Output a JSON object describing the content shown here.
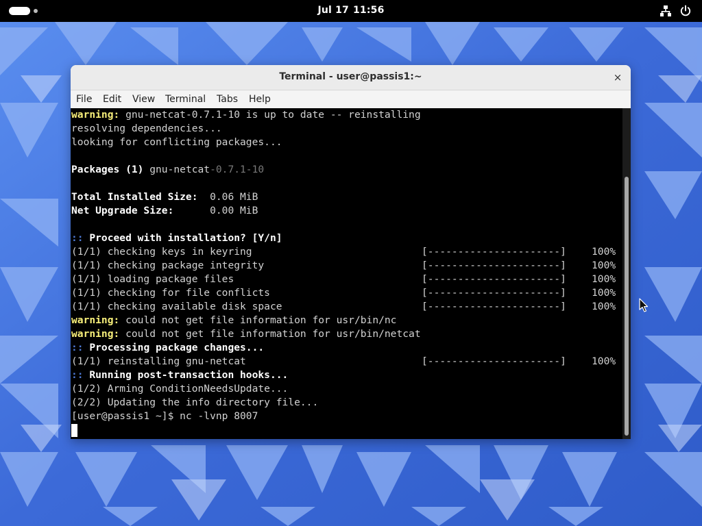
{
  "topbar": {
    "date": "Jul 17",
    "time": "11:56",
    "icons": [
      "activities-icon",
      "network-icon",
      "power-icon"
    ]
  },
  "window": {
    "title": "Terminal - user@passis1:~",
    "close_glyph": "×"
  },
  "menubar": {
    "items": [
      {
        "label": "File"
      },
      {
        "label": "Edit"
      },
      {
        "label": "View"
      },
      {
        "label": "Terminal"
      },
      {
        "label": "Tabs"
      },
      {
        "label": "Help"
      }
    ]
  },
  "terminal": {
    "lines": [
      {
        "segments": [
          {
            "t": "warning:",
            "c": "warn"
          },
          {
            "t": " gnu-netcat-0.7.1-10 is up to date -- reinstalling",
            "c": ""
          }
        ]
      },
      {
        "segments": [
          {
            "t": "resolving dependencies...",
            "c": ""
          }
        ]
      },
      {
        "segments": [
          {
            "t": "looking for conflicting packages...",
            "c": ""
          }
        ]
      },
      {
        "segments": []
      },
      {
        "segments": [
          {
            "t": "Packages (1)",
            "c": "b"
          },
          {
            "t": " gnu-netcat",
            "c": ""
          },
          {
            "t": "-0.7.1-10",
            "c": "dim"
          }
        ]
      },
      {
        "segments": []
      },
      {
        "segments": [
          {
            "t": "Total Installed Size:",
            "c": "b"
          },
          {
            "t": "  0.06 MiB",
            "c": ""
          }
        ]
      },
      {
        "segments": [
          {
            "t": "Net Upgrade Size:",
            "c": "b"
          },
          {
            "t": "      0.00 MiB",
            "c": ""
          }
        ]
      },
      {
        "segments": []
      },
      {
        "segments": [
          {
            "t": "::",
            "c": "blue"
          },
          {
            "t": " Proceed with installation? [Y/n]",
            "c": "b"
          }
        ]
      },
      {
        "segments": [
          {
            "t": "(1/1) checking keys in keyring",
            "c": ""
          }
        ],
        "bar": "[----------------------]",
        "pct": "100%"
      },
      {
        "segments": [
          {
            "t": "(1/1) checking package integrity",
            "c": ""
          }
        ],
        "bar": "[----------------------]",
        "pct": "100%"
      },
      {
        "segments": [
          {
            "t": "(1/1) loading package files",
            "c": ""
          }
        ],
        "bar": "[----------------------]",
        "pct": "100%"
      },
      {
        "segments": [
          {
            "t": "(1/1) checking for file conflicts",
            "c": ""
          }
        ],
        "bar": "[----------------------]",
        "pct": "100%"
      },
      {
        "segments": [
          {
            "t": "(1/1) checking available disk space",
            "c": ""
          }
        ],
        "bar": "[----------------------]",
        "pct": "100%"
      },
      {
        "segments": [
          {
            "t": "warning:",
            "c": "warn"
          },
          {
            "t": " could not get file information for usr/bin/nc",
            "c": ""
          }
        ]
      },
      {
        "segments": [
          {
            "t": "warning:",
            "c": "warn"
          },
          {
            "t": " could not get file information for usr/bin/netcat",
            "c": ""
          }
        ]
      },
      {
        "segments": [
          {
            "t": "::",
            "c": "blue"
          },
          {
            "t": " Processing package changes...",
            "c": "b"
          }
        ]
      },
      {
        "segments": [
          {
            "t": "(1/1) reinstalling gnu-netcat",
            "c": ""
          }
        ],
        "bar": "[----------------------]",
        "pct": "100%"
      },
      {
        "segments": [
          {
            "t": "::",
            "c": "blue"
          },
          {
            "t": " Running post-transaction hooks...",
            "c": "b"
          }
        ]
      },
      {
        "segments": [
          {
            "t": "(1/2) Arming ConditionNeedsUpdate...",
            "c": ""
          }
        ]
      },
      {
        "segments": [
          {
            "t": "(2/2) Updating the info directory file...",
            "c": ""
          }
        ]
      },
      {
        "segments": [
          {
            "t": "[user@passis1 ~]$ nc -lvnp 8007",
            "c": ""
          }
        ]
      }
    ]
  }
}
